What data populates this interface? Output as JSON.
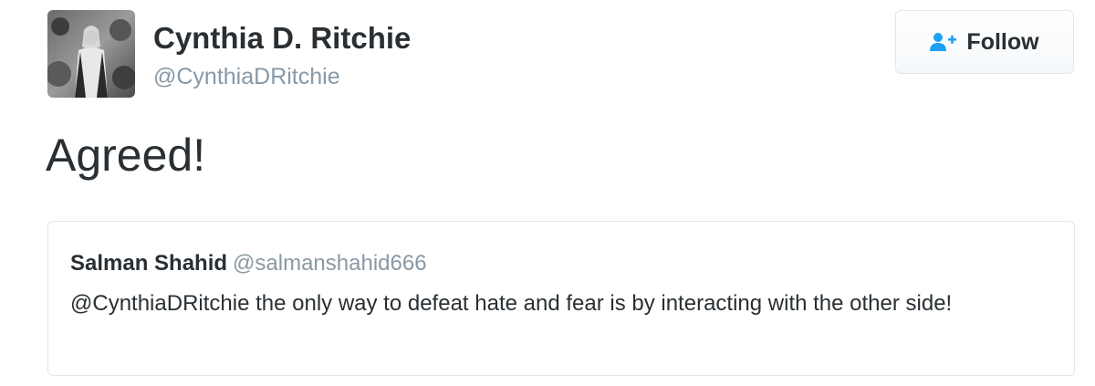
{
  "author": {
    "name": "Cynthia D. Ritchie",
    "handle": "@CynthiaDRitchie",
    "avatar_icon": "profile-photo"
  },
  "follow_button": {
    "label": "Follow",
    "icon": "follow-user-plus-icon",
    "icon_color": "#1da1f2"
  },
  "tweet": {
    "text": "Agreed!"
  },
  "quoted_tweet": {
    "author_name": "Salman Shahid",
    "author_handle": "@salmanshahid666",
    "text": "@CynthiaDRitchie the only way to defeat hate and fear is by interacting with the other side!"
  },
  "colors": {
    "text_primary": "#292f33",
    "text_secondary": "#8899a6",
    "border": "#e1e8ed",
    "accent": "#1da1f2"
  }
}
